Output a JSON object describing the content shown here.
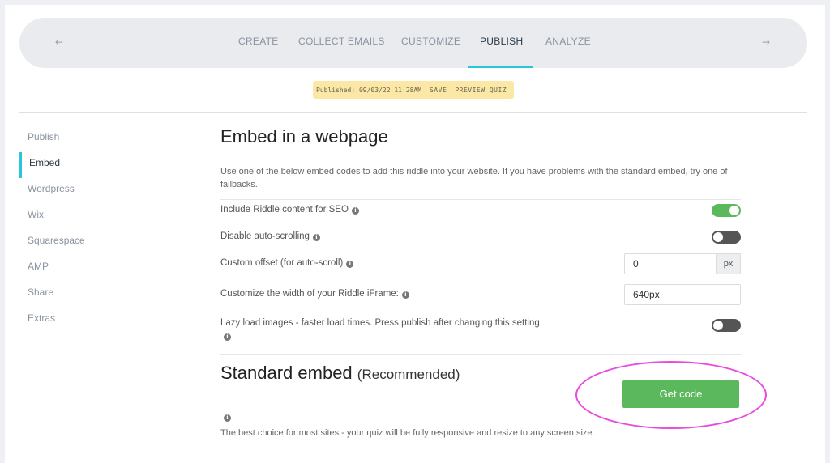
{
  "nav": {
    "prev_icon": "arrow-left-icon",
    "next_icon": "arrow-right-icon",
    "prev_glyph": "←",
    "next_glyph": "→",
    "tabs": [
      {
        "label": "CREATE"
      },
      {
        "label": "COLLECT EMAILS"
      },
      {
        "label": "CUSTOMIZE"
      },
      {
        "label": "PUBLISH",
        "active": true
      },
      {
        "label": "ANALYZE"
      }
    ],
    "accent_color": "#2bc5d8"
  },
  "status": {
    "published": "Published: 09/03/22 11:28AM",
    "save": "SAVE",
    "preview": "PREVIEW QUIZ",
    "bg_color": "#fbe8a6"
  },
  "sidebar": {
    "items": [
      {
        "label": "Publish"
      },
      {
        "label": "Embed",
        "active": true
      },
      {
        "label": "Wordpress"
      },
      {
        "label": "Wix"
      },
      {
        "label": "Squarespace"
      },
      {
        "label": "AMP"
      },
      {
        "label": "Share"
      },
      {
        "label": "Extras"
      }
    ]
  },
  "embed": {
    "title": "Embed in a webpage",
    "description": "Use one of the below embed codes to add this riddle into your website. If you have problems with the standard embed, try one of fallbacks.",
    "settings": {
      "seo_label": "Include Riddle content for SEO",
      "seo_on": true,
      "autoscroll_label": "Disable auto-scrolling",
      "autoscroll_on": false,
      "offset_label": "Custom offset (for auto-scroll)",
      "offset_value": "0",
      "offset_unit": "px",
      "width_label": "Customize the width of your Riddle iFrame:",
      "width_value": "640px",
      "lazy_label": "Lazy load images - faster load times. Press publish after changing this setting.",
      "lazy_on": false
    },
    "info_glyph": "i"
  },
  "standard": {
    "title": "Standard embed",
    "title_suffix": "(Recommended)",
    "button": "Get code",
    "description": "The best choice for most sites - your quiz will be fully responsive and resize to any screen size.",
    "button_color": "#5cb85c",
    "highlight_color": "#e84be0"
  }
}
